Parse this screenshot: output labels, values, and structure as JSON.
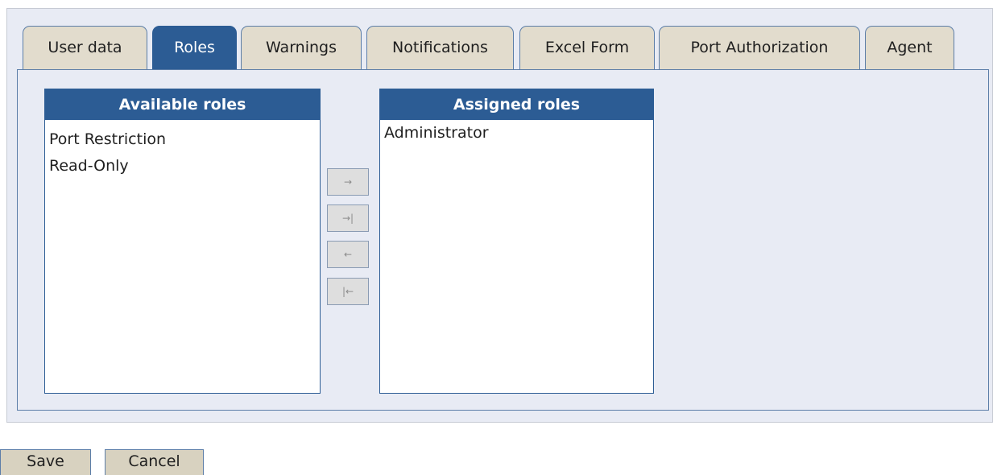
{
  "tabs": {
    "user_data": "User data",
    "roles": "Roles",
    "warnings": "Warnings",
    "notifications": "Notifications",
    "excel_form": "Excel Form",
    "port_authorization": "Port Authorization",
    "agent": "Agent",
    "active": "Roles"
  },
  "available_roles": {
    "header": "Available roles",
    "items": [
      "Port Restriction",
      "Read-Only"
    ]
  },
  "assigned_roles": {
    "header": "Assigned roles",
    "items": [
      "Administrator"
    ]
  },
  "move_buttons": {
    "add": "→",
    "add_all": "→|",
    "remove": "←",
    "remove_all": "|←"
  },
  "actions": {
    "save_label": "Save",
    "cancel_label": "Cancel"
  },
  "colors": {
    "accent": "#2c5c94",
    "tab_background": "#e2dccd",
    "panel_background": "#e8ebf4"
  }
}
